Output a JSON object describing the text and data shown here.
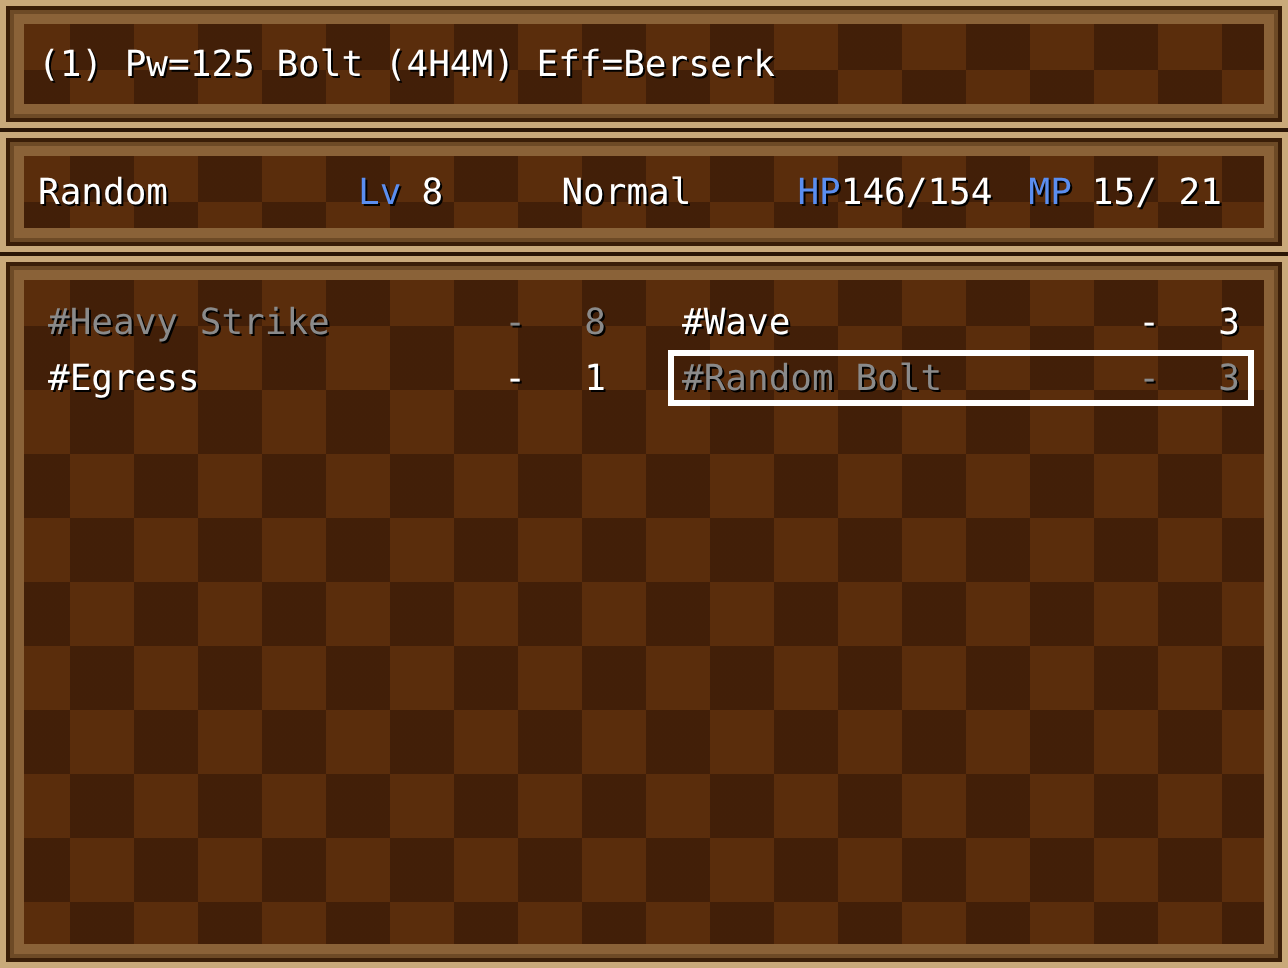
{
  "help": {
    "text": "(1) Pw=125 Bolt (4H4M) Eff=Berserk"
  },
  "status": {
    "name": "Random",
    "level_label": "Lv",
    "level": "8",
    "condition": "Normal",
    "hp_label": "HP",
    "hp": "146/154",
    "mp_label": "MP",
    "mp": "15/ 21"
  },
  "skills": [
    {
      "name": "#Heavy Strike",
      "dash": "-",
      "cost": "8",
      "disabled": true,
      "selected": false
    },
    {
      "name": "#Wave",
      "dash": "-",
      "cost": "3",
      "disabled": false,
      "selected": false
    },
    {
      "name": "#Egress",
      "dash": "-",
      "cost": "1",
      "disabled": false,
      "selected": false
    },
    {
      "name": "#Random Bolt",
      "dash": "-",
      "cost": "3",
      "disabled": true,
      "selected": true
    }
  ]
}
